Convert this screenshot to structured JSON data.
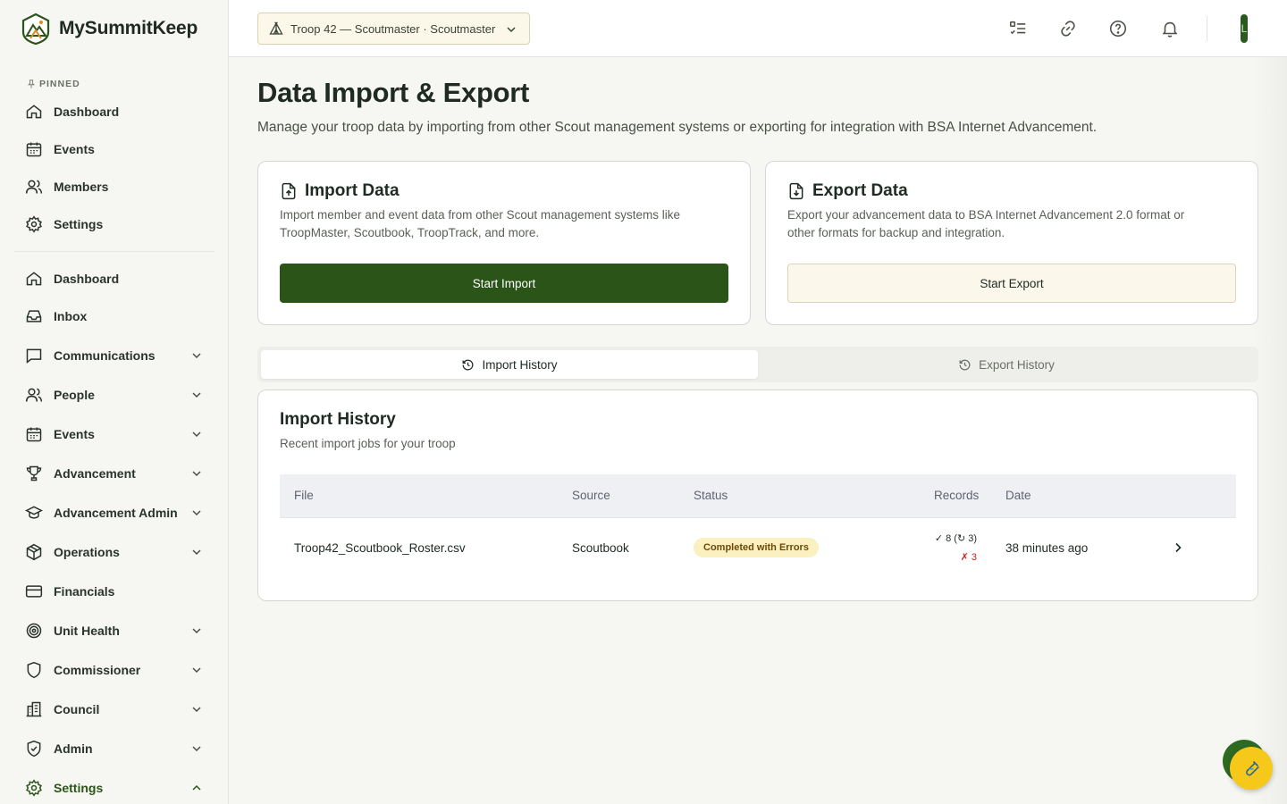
{
  "brand": {
    "name": "MySummitKeep"
  },
  "sidebar": {
    "pinned_label": "PINNED",
    "pinned": [
      {
        "label": "Dashboard",
        "icon": "home-icon"
      },
      {
        "label": "Events",
        "icon": "calendar-icon"
      },
      {
        "label": "Members",
        "icon": "users-icon"
      },
      {
        "label": "Settings",
        "icon": "gear-icon"
      }
    ],
    "items": [
      {
        "label": "Dashboard",
        "icon": "home-icon",
        "expandable": false
      },
      {
        "label": "Inbox",
        "icon": "inbox-icon",
        "expandable": false
      },
      {
        "label": "Communications",
        "icon": "message-icon",
        "expandable": true
      },
      {
        "label": "People",
        "icon": "users-icon",
        "expandable": true
      },
      {
        "label": "Events",
        "icon": "calendar-icon",
        "expandable": true
      },
      {
        "label": "Advancement",
        "icon": "trophy-icon",
        "expandable": true
      },
      {
        "label": "Advancement Admin",
        "icon": "graduation-cap-icon",
        "expandable": true
      },
      {
        "label": "Operations",
        "icon": "box-icon",
        "expandable": true
      },
      {
        "label": "Financials",
        "icon": "credit-card-icon",
        "expandable": false
      },
      {
        "label": "Unit Health",
        "icon": "target-icon",
        "expandable": true
      },
      {
        "label": "Commissioner",
        "icon": "shield-icon",
        "expandable": true
      },
      {
        "label": "Council",
        "icon": "building-icon",
        "expandable": true
      },
      {
        "label": "Admin",
        "icon": "shield-check-icon",
        "expandable": true
      },
      {
        "label": "Settings",
        "icon": "gear-icon",
        "expandable": true,
        "expanded": true
      }
    ]
  },
  "header": {
    "troop_select": "Troop 42 — Scoutmaster · Scoutmaster",
    "icons": [
      "checklist-icon",
      "link-icon",
      "help-icon",
      "bell-icon"
    ],
    "avatar_initial": "L"
  },
  "page": {
    "title": "Data Import & Export",
    "description": "Manage your troop data by importing from other Scout management systems or exporting for integration with BSA Internet Advancement."
  },
  "import_card": {
    "title": "Import Data",
    "description": "Import member and event data from other Scout management systems like TroopMaster, Scoutbook, TroopTrack, and more.",
    "button": "Start Import"
  },
  "export_card": {
    "title": "Export Data",
    "description": "Export your advancement data to BSA Internet Advancement 2.0 format or other formats for backup and integration.",
    "button": "Start Export"
  },
  "tabs": [
    {
      "label": "Import History",
      "active": true
    },
    {
      "label": "Export History",
      "active": false
    }
  ],
  "history": {
    "title": "Import History",
    "subtitle": "Recent import jobs for your troop",
    "columns": [
      "File",
      "Source",
      "Status",
      "Records",
      "Date"
    ],
    "rows": [
      {
        "file": "Troop42_Scoutbook_Roster.csv",
        "source": "Scoutbook",
        "status": "Completed with Errors",
        "records_ok": "✓ 8 (↻ 3)",
        "records_err": "✗ 3",
        "date": "38 minutes ago"
      }
    ]
  },
  "colors": {
    "primary": "#2a5418",
    "status_badge_bg": "#fbf0c0",
    "error": "#cc2222"
  }
}
